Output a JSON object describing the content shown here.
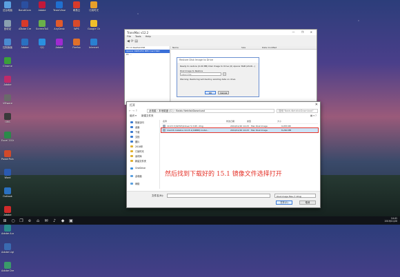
{
  "desktop_icons": [
    {
      "label": "这台电脑",
      "color": "#5aa0e0"
    },
    {
      "label": "BandiCam",
      "color": "#2a4fa0"
    },
    {
      "label": "Adobe",
      "color": "#c2183a"
    },
    {
      "label": "TeamViewer",
      "color": "#1f6fd0"
    },
    {
      "label": "网易云",
      "color": "#d83a2a"
    },
    {
      "label": "订阅时光",
      "color": "#e8a02a"
    },
    {
      "label": "回收站",
      "color": "#8aa0b0"
    },
    {
      "label": "Adobe Creat..",
      "color": "#d83a2a"
    },
    {
      "label": "ScreenToGif",
      "color": "#6ab04a"
    },
    {
      "label": "AnyDesk",
      "color": "#e05a2a"
    },
    {
      "label": "WPS",
      "color": "#d84a2a"
    },
    {
      "label": "Google Chrome",
      "color": "#f0c02a"
    },
    {
      "label": "控制面板",
      "color": "#4a8ad0"
    },
    {
      "label": "Adobe",
      "color": "#2a70c0"
    },
    {
      "label": "QQ",
      "color": "#2a90e0"
    },
    {
      "label": "Adobe",
      "color": "#a02ad0"
    },
    {
      "label": "Firefox",
      "color": "#e0702a"
    },
    {
      "label": "Internet",
      "color": "#2a80d0"
    },
    {
      "label": "Chrome",
      "color": "#3aa03a"
    },
    {
      "label": "Adobe",
      "color": "#c02a6a"
    },
    {
      "label": "VMware",
      "color": "#6a6a6a"
    },
    {
      "label": "OBS",
      "color": "#3a3a3a"
    },
    {
      "label": "Excel 2016",
      "color": "#2a8a4a"
    },
    {
      "label": "PowerPoint",
      "color": "#d04a2a"
    },
    {
      "label": "Word",
      "color": "#2a5ab0"
    },
    {
      "label": "Outlook",
      "color": "#2a70c0"
    },
    {
      "label": "Adobe",
      "color": "#d02a2a"
    },
    {
      "label": "Adobe Audition",
      "color": "#2a8a8a"
    },
    {
      "label": "Adobe Lightroom",
      "color": "#3a6ab0"
    },
    {
      "label": "Adobe Dreamwe..",
      "color": "#3a9a6a"
    }
  ],
  "transmac": {
    "title": "TransMac v12.2",
    "menu": [
      "File",
      "Tools",
      "Help"
    ],
    "tree": [
      "PC 14 RealtekUSB",
      "Apacer ASM105X MED Card SSD",
      "PC ..."
    ],
    "columns": [
      "Name",
      "Size",
      "Date modified"
    ]
  },
  "restore_dialog": {
    "title": "Restore Disk Image to Drive",
    "line1": "Ready to restore (0.00 MB) Disk Image to Drive (0) Apacer 8GB (AS16...)",
    "line2": "Disk Image to Restore",
    "placeholder": "select file",
    "warning": "Warning: Restoring will destroy existing data on drive",
    "ok": "OK",
    "cancel": "Cancel"
  },
  "open_dialog": {
    "title": "打开",
    "path": "此电脑 › 本地磁盘 (C:) › Baidu NetdiskDownload",
    "search_placeholder": "搜索\"BaiduNetdiskDownload\"",
    "organize": "组织 ▾",
    "new_folder": "新建文件夹",
    "nav": [
      {
        "label": "快速访问",
        "color": "#3a7ad0"
      },
      {
        "label": "桌面",
        "color": "#3a7ad0"
      },
      {
        "label": "下载",
        "color": "#3a7ad0"
      },
      {
        "label": "文档",
        "color": "#3a7ad0"
      },
      {
        "label": "图片",
        "color": "#3a7ad0"
      },
      {
        "label": "2018年",
        "color": "#e0b030"
      },
      {
        "label": "订阅时光",
        "color": "#e0b030"
      },
      {
        "label": "素材库",
        "color": "#e0b030"
      },
      {
        "label": "新建文件夹",
        "color": "#e0b030"
      },
      {
        "label": "",
        "color": ""
      },
      {
        "label": "OneDrive",
        "color": "#3a90e0"
      },
      {
        "label": "",
        "color": ""
      },
      {
        "label": "此电脑",
        "color": "#5aa0e0"
      },
      {
        "label": "",
        "color": ""
      },
      {
        "label": "网络",
        "color": "#5aa0e0"
      }
    ],
    "columns": [
      "名称",
      "修改日期",
      "类型",
      "大小"
    ],
    "files": [
      {
        "name": "10.15.7(19H15)Clover 5.3 R5 .dmg",
        "date": "2019/11/20 14:23",
        "type": "Mac Disk Image",
        "size": "9,053 KB"
      },
      {
        "name": "macOS Catalina 10.15.1(19B88) Instal...",
        "date": "2019/11/20 14:23",
        "type": "Mac Disk Image",
        "size": "8,260 MB"
      }
    ],
    "caption": "然后找到下载好的 15.1 镜像文件选择打开",
    "filename_label": "文件名(N):",
    "filetype": "Disk Image files (*.dmg)",
    "open": "打开(O)",
    "cancel": "取消"
  },
  "taskbar": {
    "items": [
      "⊞",
      "○",
      "❐",
      "e",
      "⌂",
      "✉",
      "♪",
      "◆",
      "▣"
    ],
    "time": "14:41",
    "date": "2019/11/20"
  }
}
